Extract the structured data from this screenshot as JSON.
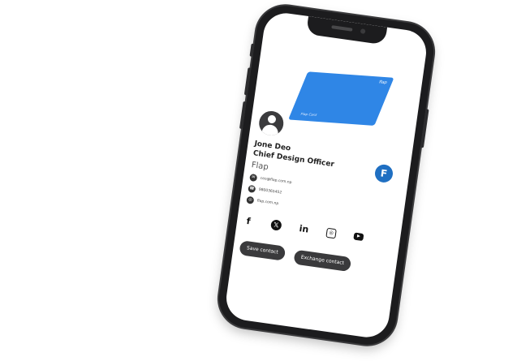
{
  "card": {
    "logo_text": "flap",
    "card_label": "Flap Card"
  },
  "profile": {
    "name": "Jone Deo",
    "job_title": "Chief Design Officer",
    "company": "Flap"
  },
  "contacts": {
    "email": "ceo@flap.com.np",
    "phone": "9800365452",
    "website": "flap.com.np"
  },
  "socials": [
    {
      "name": "facebook",
      "glyph": "f"
    },
    {
      "name": "x-twitter",
      "glyph": "𝕏"
    },
    {
      "name": "linkedin",
      "glyph": "in"
    },
    {
      "name": "instagram",
      "glyph": "◎"
    },
    {
      "name": "youtube",
      "glyph": "▶"
    }
  ],
  "actions": {
    "save_label": "Save contact",
    "exchange_label": "Exchange contact"
  },
  "colors": {
    "card_blue": "#2f86e6",
    "brand_blue": "#1f6fc2",
    "button_dark": "#3a3a3c"
  }
}
